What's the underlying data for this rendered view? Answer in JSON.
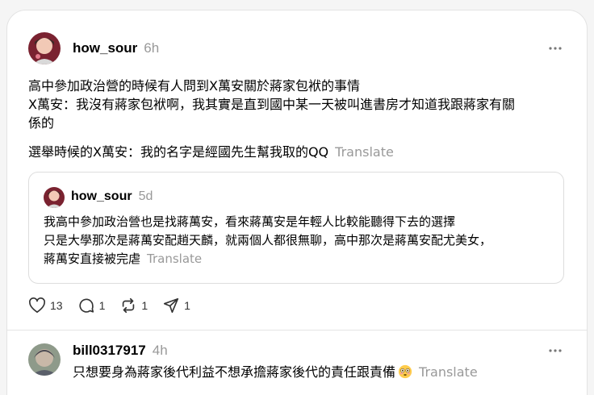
{
  "post1": {
    "username": "how_sour",
    "time": "6h",
    "line1": "高中參加政治營的時候有人問到X萬安關於蔣家包袱的事情",
    "line2": "X萬安：我沒有蔣家包袱啊，我其實是直到國中某一天被叫進書房才知道我跟蔣家有關",
    "line3": "係的",
    "line4": "選舉時候的X萬安：我的名字是經國先生幫我取的QQ",
    "translate": "Translate",
    "more_icon": "more-horizontal-icon"
  },
  "quoted": {
    "username": "how_sour",
    "time": "5d",
    "line1": "我高中參加政治營也是找蔣萬安，看來蔣萬安是年輕人比較能聽得下去的選擇",
    "line2": "只是大學那次是蔣萬安配趙天麟，就兩個人都很無聊，高中那次是蔣萬安配尤美女，",
    "line3": "蔣萬安直接被完虐",
    "translate": "Translate"
  },
  "actions": {
    "likes": "13",
    "comments": "1",
    "reposts": "1",
    "shares": "1",
    "icons": [
      "heart-icon",
      "comment-icon",
      "repost-icon",
      "share-icon"
    ]
  },
  "post2": {
    "username": "bill0317917",
    "time": "4h",
    "text": "只想要身為蔣家後代利益不想承擔蔣家後代的責任跟責備",
    "emoji": "flushed-face-emoji",
    "translate": "Translate"
  }
}
